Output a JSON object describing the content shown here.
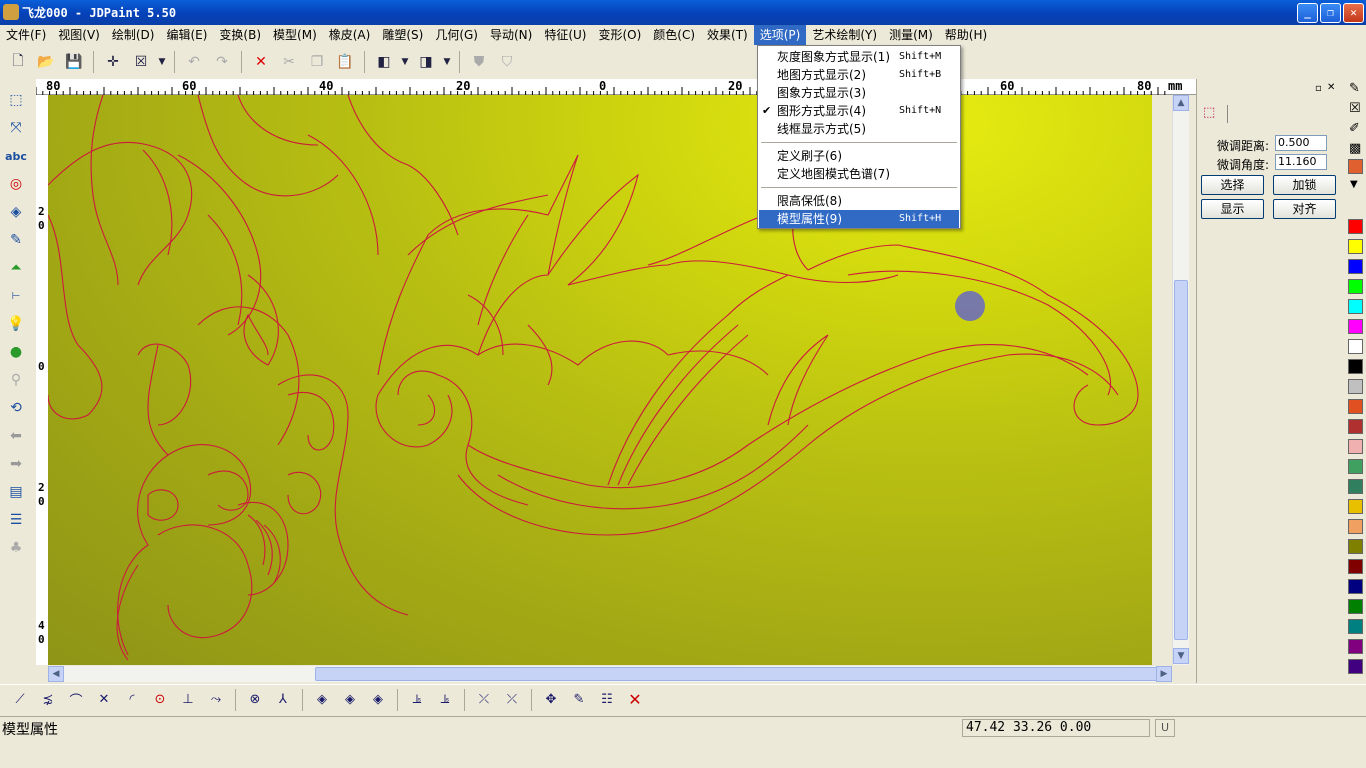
{
  "window": {
    "title": "飞龙000 - JDPaint 5.50",
    "minimize": "_",
    "maximize": "❐",
    "close": "✕"
  },
  "menu": [
    {
      "label": "文件(F)"
    },
    {
      "label": "视图(V)"
    },
    {
      "label": "绘制(D)"
    },
    {
      "label": "编辑(E)"
    },
    {
      "label": "变换(B)"
    },
    {
      "label": "模型(M)"
    },
    {
      "label": "橡皮(A)"
    },
    {
      "label": "雕塑(S)"
    },
    {
      "label": "几何(G)"
    },
    {
      "label": "导动(N)"
    },
    {
      "label": "特征(U)"
    },
    {
      "label": "变形(O)"
    },
    {
      "label": "颜色(C)"
    },
    {
      "label": "效果(T)"
    },
    {
      "label": "选项(P)"
    },
    {
      "label": "艺术绘制(Y)"
    },
    {
      "label": "测量(M)"
    },
    {
      "label": "帮助(H)"
    }
  ],
  "dropdown": {
    "items": [
      {
        "label": "灰度图象方式显示(1)",
        "shortcut": "Shift+M"
      },
      {
        "label": "地图方式显示(2)",
        "shortcut": "Shift+B"
      },
      {
        "label": "图象方式显示(3)",
        "shortcut": ""
      },
      {
        "label": "图形方式显示(4)",
        "shortcut": "Shift+N",
        "check": "✔"
      },
      {
        "label": "线框显示方式(5)",
        "shortcut": ""
      },
      {
        "label": "定义刷子(6)",
        "shortcut": ""
      },
      {
        "label": "定义地图模式色谱(7)",
        "shortcut": ""
      },
      {
        "label": "限高保低(8)",
        "shortcut": ""
      },
      {
        "label": "模型属性(9)",
        "shortcut": "Shift+H"
      }
    ]
  },
  "ruler_top": {
    "unit": "mm",
    "ticks": [
      "80",
      "60",
      "40",
      "20",
      "0",
      "20",
      "40",
      "60",
      "80"
    ]
  },
  "ruler_left": {
    "ticks": [
      "2\n0",
      "0",
      "2\n0",
      "4\n0"
    ]
  },
  "panel": {
    "dist_label": "微调距离:",
    "dist_value": "0.500",
    "angle_label": "微调角度:",
    "angle_value": "11.160",
    "select": "选择",
    "lock": "加锁",
    "show": "显示",
    "align": "对齐"
  },
  "palette": [
    "#ff0000",
    "#ffff00",
    "#0000ff",
    "#00ff00",
    "#00ffff",
    "#ff00ff",
    "#ffffff",
    "#000000",
    "#c0c0c0",
    "#e05020",
    "#b03030",
    "#f0b0b0",
    "#40a060",
    "#308060",
    "#e8c000",
    "#f0a060",
    "#808000",
    "#800000",
    "#000080",
    "#008000",
    "#008080",
    "#800080",
    "#400080"
  ],
  "status": {
    "text": "模型属性",
    "coords": "47.42 33.26 0.00",
    "indicator": "U"
  },
  "colors": {
    "accent": "#316ac5",
    "curve": "#cc1a3c"
  }
}
